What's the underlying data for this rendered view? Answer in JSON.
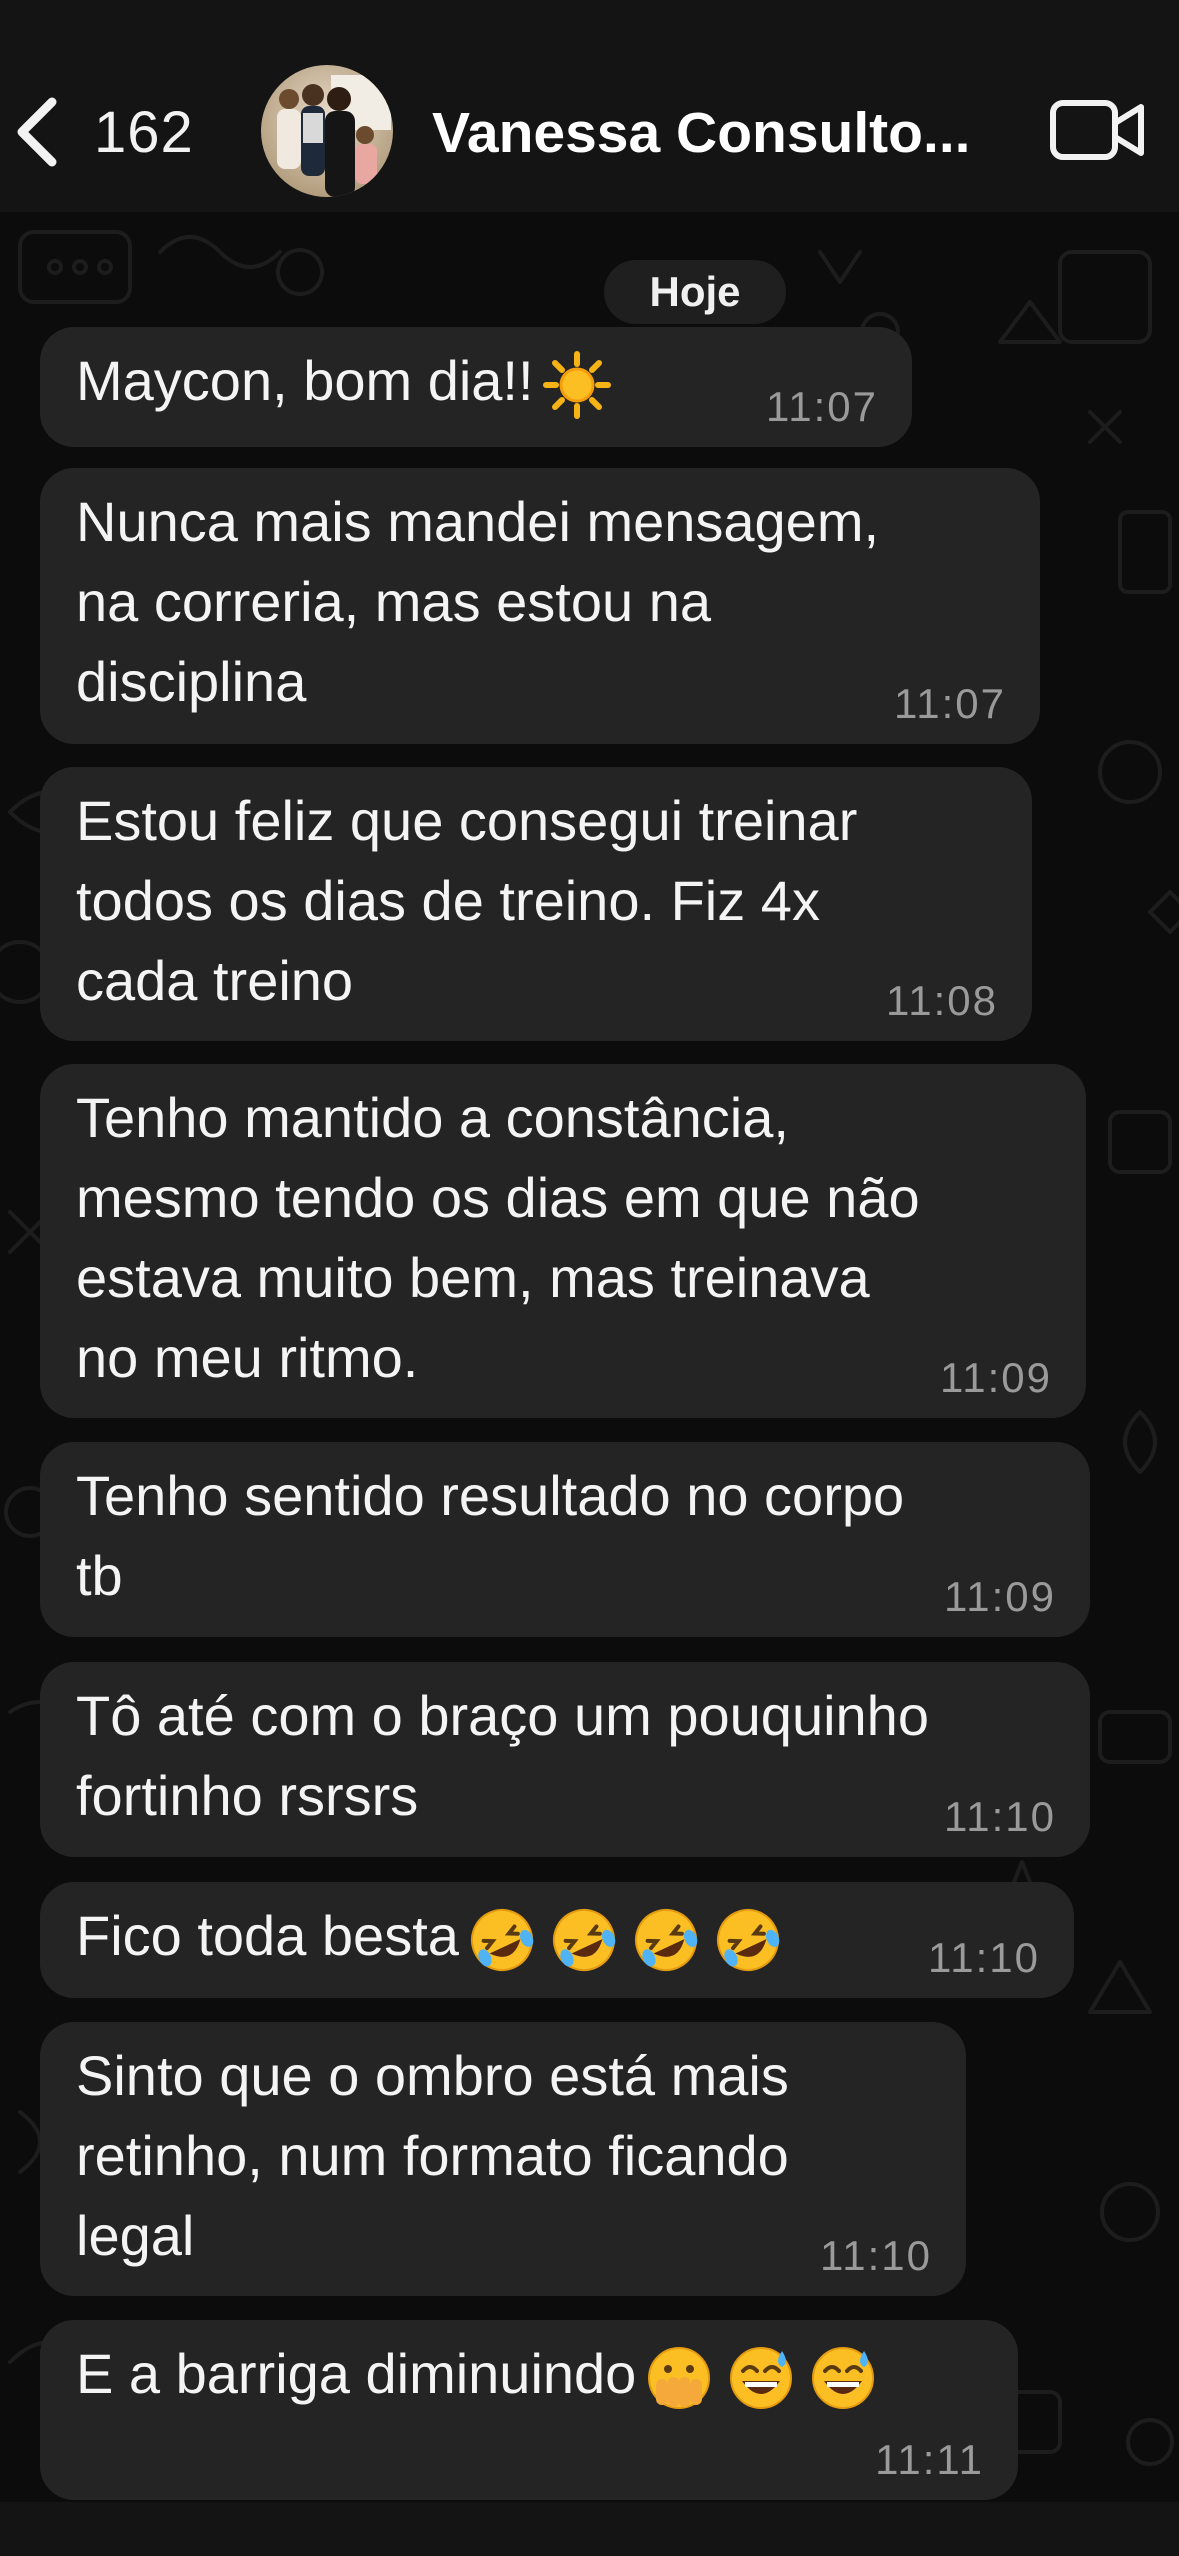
{
  "header": {
    "back_count": "162",
    "contact_name": "Vanessa Consulto...",
    "icons": [
      "chevron-left-icon",
      "contact-avatar",
      "video-call-icon"
    ]
  },
  "chat": {
    "date_label": "Hoje",
    "messages": [
      {
        "text": "Maycon, bom dia!!",
        "emoji": [
          "sun"
        ],
        "time": "11:07"
      },
      {
        "text": "Nunca mais mandei mensagem,\nna correria, mas estou na\ndisciplina",
        "time": "11:07"
      },
      {
        "text": "Estou feliz que consegui treinar\ntodos os dias de treino. Fiz 4x\ncada treino",
        "time": "11:08"
      },
      {
        "text": "Tenho mantido a constância,\nmesmo tendo os dias em que não\nestava muito bem, mas treinava\nno meu ritmo.",
        "time": "11:09"
      },
      {
        "text": "Tenho sentido resultado no corpo\ntb",
        "time": "11:09"
      },
      {
        "text": "Tô até com o braço um pouquinho\nfortinho rsrsrs",
        "time": "11:10"
      },
      {
        "text": "Fico toda besta",
        "emoji": [
          "rolling-on-floor-laughing",
          "rolling-on-floor-laughing",
          "rolling-on-floor-laughing",
          "rolling-on-floor-laughing"
        ],
        "time": "11:10"
      },
      {
        "text": "Sinto que o ombro está mais\nretinho, num formato ficando\nlegal",
        "time": "11:10"
      },
      {
        "text": "E a barriga diminuindo",
        "emoji": [
          "face-with-open-eyes-and-hand-over-mouth",
          "grinning-face-with-sweat",
          "grinning-face-with-sweat"
        ],
        "time": "11:11"
      }
    ]
  },
  "colors": {
    "header_bg": "#141414",
    "chat_bg": "#0c0c0c",
    "bubble_bg": "#242424",
    "text": "#f4f4f4",
    "time": "#9a9a9a"
  }
}
